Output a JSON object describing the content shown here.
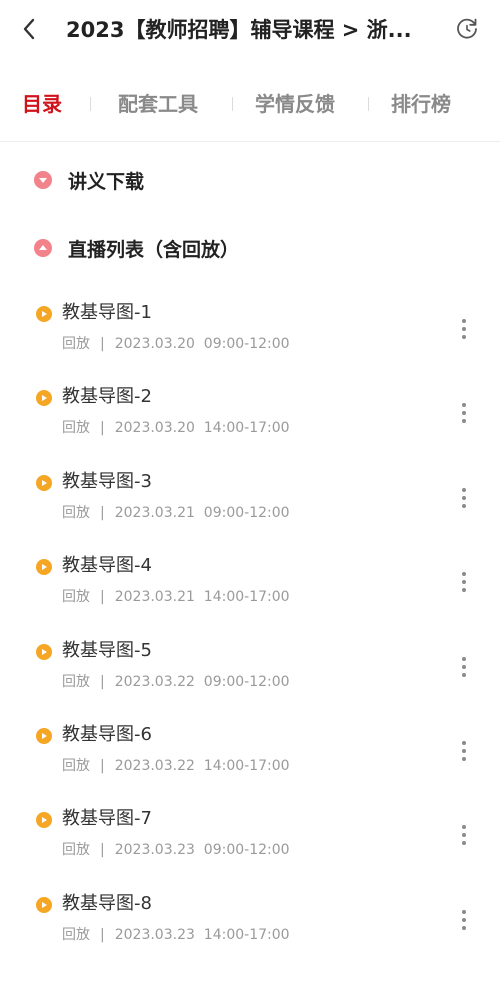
{
  "header": {
    "title": "2023【教师招聘】辅导课程 > 浙...",
    "back_icon": "back-arrow-icon",
    "refresh_icon": "refresh-icon"
  },
  "tabs": [
    {
      "label": "目录",
      "active": true
    },
    {
      "label": "配套工具",
      "active": false
    },
    {
      "label": "学情反馈",
      "active": false
    },
    {
      "label": "排行榜",
      "active": false
    }
  ],
  "sections": {
    "handouts": {
      "label": "讲义下载",
      "state": "collapsed"
    },
    "live": {
      "label": "直播列表（含回放）",
      "state": "expanded"
    }
  },
  "lessons": [
    {
      "title": "教基导图-1",
      "status": "回放",
      "sep": "|",
      "date": "2023.03.20",
      "time": "09:00-12:00"
    },
    {
      "title": "教基导图-2",
      "status": "回放",
      "sep": "|",
      "date": "2023.03.20",
      "time": "14:00-17:00"
    },
    {
      "title": "教基导图-3",
      "status": "回放",
      "sep": "|",
      "date": "2023.03.21",
      "time": "09:00-12:00"
    },
    {
      "title": "教基导图-4",
      "status": "回放",
      "sep": "|",
      "date": "2023.03.21",
      "time": "14:00-17:00"
    },
    {
      "title": "教基导图-5",
      "status": "回放",
      "sep": "|",
      "date": "2023.03.22",
      "time": "09:00-12:00"
    },
    {
      "title": "教基导图-6",
      "status": "回放",
      "sep": "|",
      "date": "2023.03.22",
      "time": "14:00-17:00"
    },
    {
      "title": "教基导图-7",
      "status": "回放",
      "sep": "|",
      "date": "2023.03.23",
      "time": "09:00-12:00"
    },
    {
      "title": "教基导图-8",
      "status": "回放",
      "sep": "|",
      "date": "2023.03.23",
      "time": "14:00-17:00"
    }
  ],
  "colors": {
    "accent": "#d0121b",
    "tab_inactive": "#8a8a8a",
    "section_dot": "#f2838a",
    "lesson_icon": "#f5a623",
    "meta_text": "#9a9a9a"
  }
}
